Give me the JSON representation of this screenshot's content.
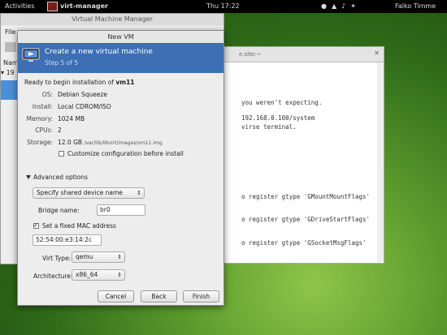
{
  "topbar": {
    "activities": "Activities",
    "app_name": "virt-manager",
    "clock": "Thu 17:22",
    "user": "Falko Timme"
  },
  "terminal": {
    "title_suffix": "e.site:~",
    "lines": [
      "you weren't expecting.",
      "192.168.0.100/system",
      "virse terminal.",
      "o register gtype 'GMountMountFlags'",
      "o register gtype 'GDriveStartFlags'",
      "o register gtype 'GSocketMsgFlags'"
    ]
  },
  "vmm": {
    "title": "Virtual Machine Manager",
    "menu_file": "File",
    "col_label": "Name",
    "row_label": "19"
  },
  "dialog": {
    "title": "New VM",
    "banner_title": "Create a new virtual machine",
    "banner_step": "Step 5 of 5",
    "ready_text": "Ready to begin installation of",
    "vm_name": "vm11",
    "os_label": "OS:",
    "os_value": "Debian Squeeze",
    "install_label": "Install:",
    "install_value": "Local CDROM/ISO",
    "memory_label": "Memory:",
    "memory_value": "1024 MB",
    "cpus_label": "CPUs:",
    "cpus_value": "2",
    "storage_label": "Storage:",
    "storage_value": "12.0 GB",
    "storage_path": "/var/lib/libvirt/images/vm11.img",
    "customize_label": "Customize configuration before install",
    "advanced_label": "Advanced options",
    "network_option": "Specify shared device name",
    "bridge_label": "Bridge name:",
    "bridge_value": "br0",
    "mac_label": "Set a fixed MAC address",
    "mac_value": "52:54:00:e3:14:2c",
    "virt_type_label": "Virt Type:",
    "virt_type_value": "qemu",
    "arch_label": "Architecture:",
    "arch_value": "x86_64",
    "cancel": "Cancel",
    "back": "Back",
    "finish": "Finish"
  }
}
